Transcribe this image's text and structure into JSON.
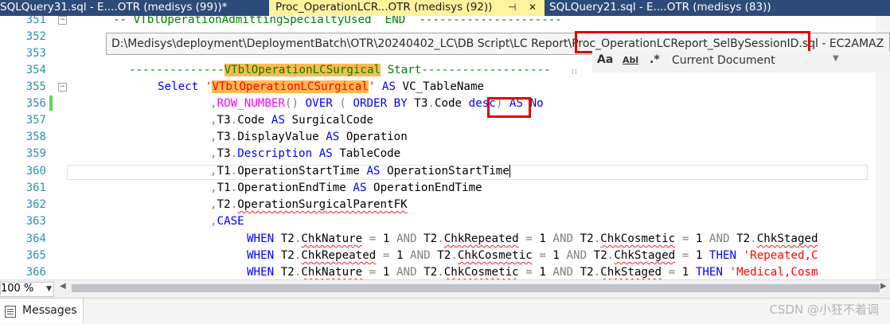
{
  "tabs": [
    {
      "label": "SQLQuery31.sql - E....OTR (medisys (99))*",
      "active": false
    },
    {
      "label": "Proc_OperationLCR...OTR (medisys (92))",
      "active": true,
      "pin": "⊣",
      "close": "✕"
    },
    {
      "label": "SQLQuery21.sql - E....OTR (medisys (83))",
      "active": false
    }
  ],
  "tooltip": {
    "path": "D:\\Medisys\\deployment\\DeploymentBatch\\OTR\\20240402_LC\\DB Script\\LC Report\\Proc_OperationLCReport_SelBySessionID.sql - EC2AMAZ",
    "highlighted": "Proc_OperationLCReport_SelBySessionID"
  },
  "find": {
    "match_case": "Aa",
    "whole_word": "Abl",
    "regex": ".*",
    "scope": "Current Document"
  },
  "zoom": "100 %",
  "messages_tab": "Messages",
  "watermark": "CSDN @小狂不着调",
  "colors": {
    "tab_strip": "#2d4b78",
    "active_tab": "#fff29d",
    "keyword": "#0000ff",
    "function": "#ff00ff",
    "string": "#ff0000",
    "comment": "#008000",
    "highlight": "#ffb950",
    "line_number": "#2b91af",
    "annotation_box": "#e00000"
  },
  "code_lines": [
    {
      "num": "351",
      "text": "    -- VTblOperationAdmittingSpecialtyUsed  END  ---------------------"
    },
    {
      "num": "352",
      "text": ""
    },
    {
      "num": "353",
      "text": ""
    },
    {
      "num": "354",
      "text": "    --------------VTblOperationLCSurgical Start--------------------"
    },
    {
      "num": "355",
      "text": "    Select 'VTblOperationLCSurgical' AS VC_TableName"
    },
    {
      "num": "356",
      "text": "        ,ROW_NUMBER() OVER ( ORDER BY T3.Code desc) AS No"
    },
    {
      "num": "357",
      "text": "        ,T3.Code AS SurgicalCode"
    },
    {
      "num": "358",
      "text": "        ,T3.DisplayValue AS Operation"
    },
    {
      "num": "359",
      "text": "        ,T3.Description AS TableCode"
    },
    {
      "num": "360",
      "text": "        ,T1.OperationStartTime AS OperationStartTime"
    },
    {
      "num": "361",
      "text": "        ,T1.OperationEndTime AS OperationEndTime"
    },
    {
      "num": "362",
      "text": "        ,T2.OperationSurgicalParentFK"
    },
    {
      "num": "363",
      "text": "        ,CASE"
    },
    {
      "num": "364",
      "text": "            WHEN T2.ChkNature = 1 AND T2.ChkRepeated = 1 AND T2.ChkCosmetic = 1 AND T2.ChkStaged"
    },
    {
      "num": "365",
      "text": "            WHEN T2.ChkRepeated = 1 AND T2.ChkCosmetic = 1 AND T2.ChkStaged = 1 THEN 'Repeated,C"
    },
    {
      "num": "366",
      "text": "            WHEN T2.ChkNature = 1 AND T2.ChkCosmetic = 1 AND T2.ChkStaged = 1 THEN 'Medical,Cosm"
    }
  ]
}
